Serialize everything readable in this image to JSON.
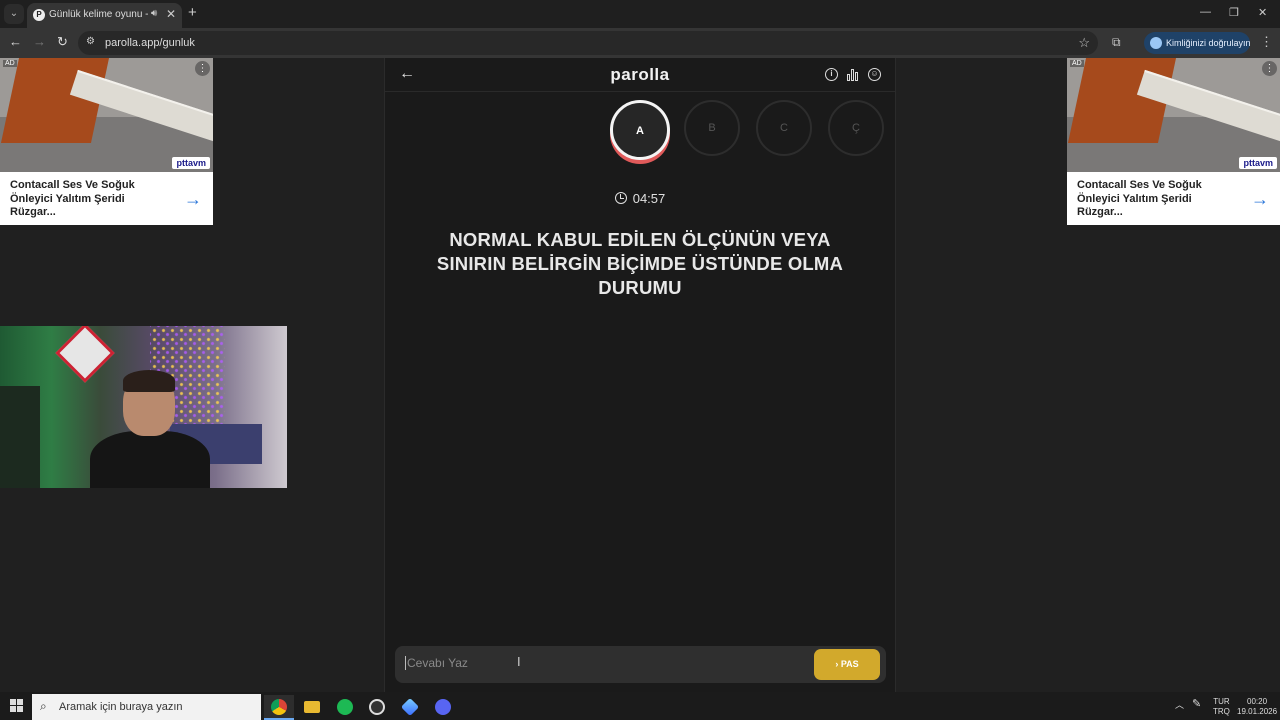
{
  "browser": {
    "tab_title": "Günlük kelime oyunu - parolla",
    "url": "parolla.app/gunluk",
    "verify_label": "Kimliğinizi doğrulayın"
  },
  "ads": [
    {
      "badge": "AD",
      "brand": "pttavm",
      "text": "Contacall Ses Ve Soğuk Önleyici Yalıtım Şeridi Rüzgar..."
    },
    {
      "badge": "AD",
      "brand": "pttavm",
      "text": "Contacall Ses Ve Soğuk Önleyici Yalıtım Şeridi Rüzgar..."
    }
  ],
  "game": {
    "logo": "parolla",
    "letters": [
      "A",
      "B",
      "C",
      "Ç"
    ],
    "active_letter": "A",
    "timer": "04:57",
    "question": "NORMAL KABUL EDİLEN ÖLÇÜNÜN VEYA SINIRIN BELİRGİN BİÇİMDE ÜSTÜNDE OLMA DURUMU",
    "answer_placeholder": "Cevabı Yaz",
    "pass_label": "PAS"
  },
  "taskbar": {
    "search_placeholder": "Aramak için buraya yazın",
    "lang_top": "TUR",
    "lang_bottom": "TRQ",
    "time": "00:20",
    "date": "19.01.2026",
    "apps": [
      "chrome-icon",
      "file-explorer-icon",
      "spotify-icon",
      "obs-icon",
      "app-icon",
      "discord-icon"
    ]
  },
  "colors": {
    "accent_yellow": "#d2a92c",
    "active_ring_shadow": "#e05a5a",
    "ad_arrow": "#2a75d8"
  }
}
